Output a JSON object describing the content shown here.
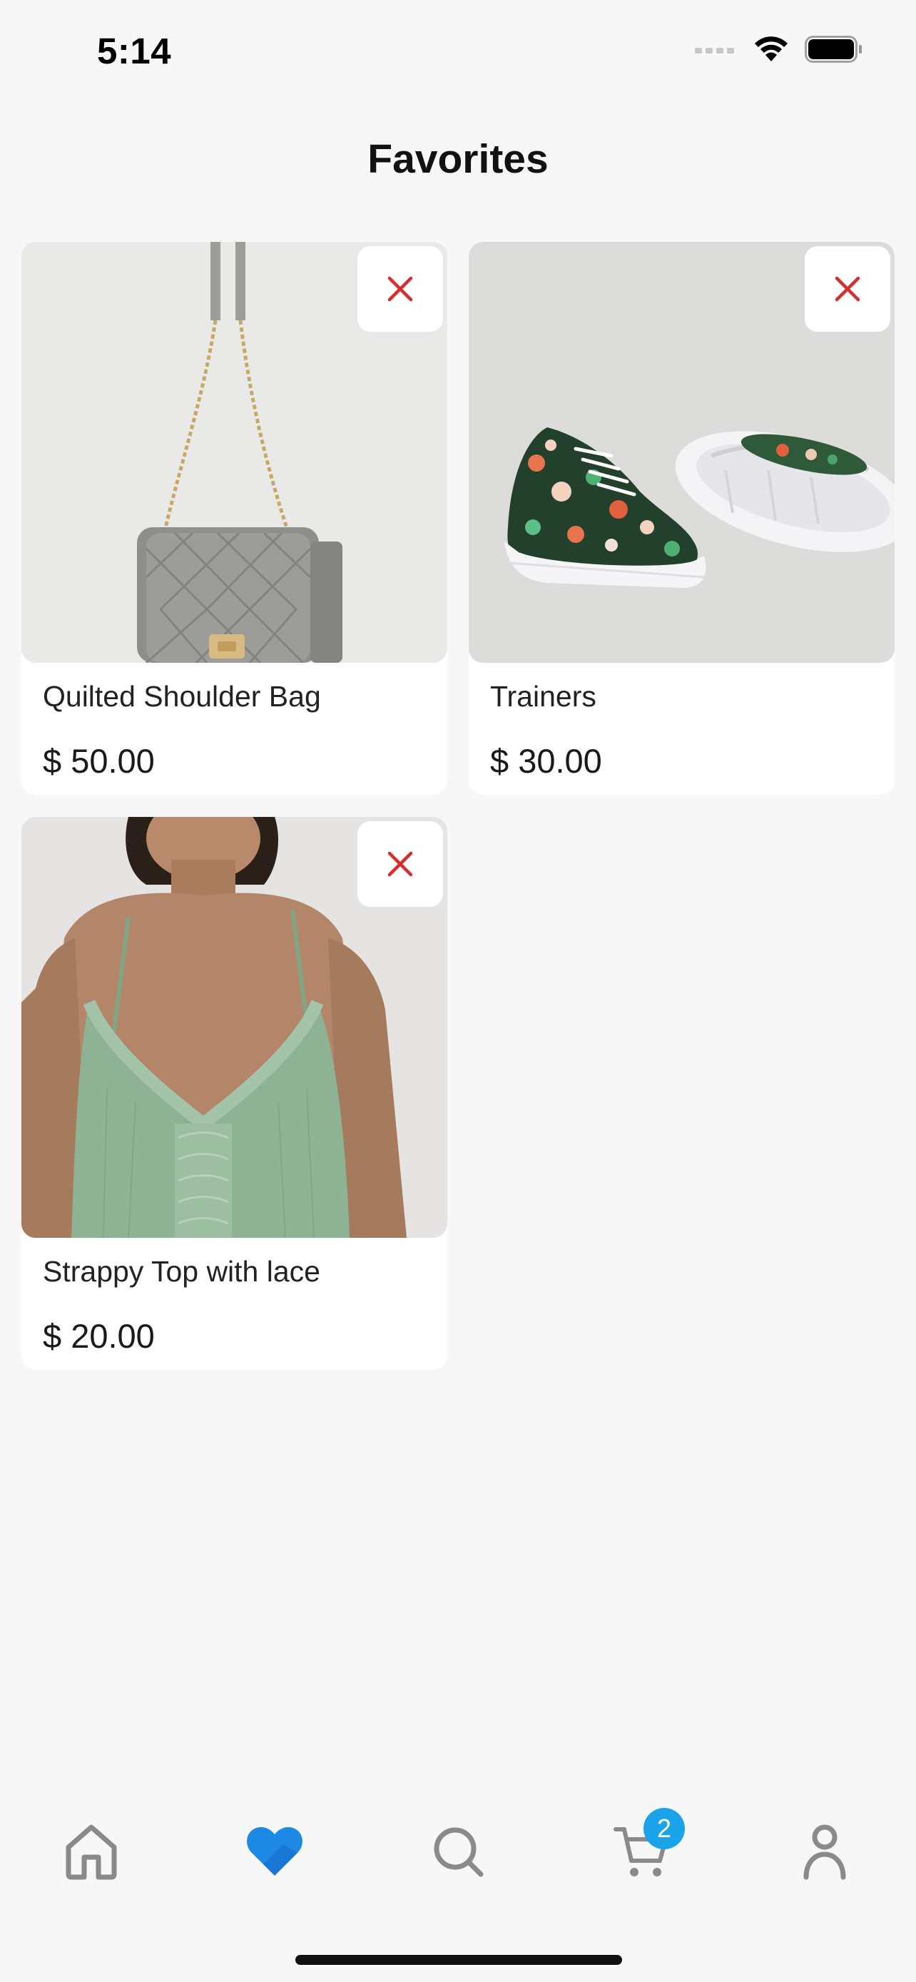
{
  "status_bar": {
    "time": "5:14",
    "icons": [
      "cellular-signal-icon",
      "wifi-icon",
      "battery-icon"
    ]
  },
  "page": {
    "title": "Favorites"
  },
  "favorites": [
    {
      "name": "Quilted Shoulder Bag",
      "price": "$ 50.00",
      "image": "grey-quilted-shoulder-bag-photo"
    },
    {
      "name": "Trainers",
      "price": "$ 30.00",
      "image": "floral-trainers-photo"
    },
    {
      "name": "Strappy Top with lace",
      "price": "$ 20.00",
      "image": "green-strappy-lace-top-photo"
    }
  ],
  "tab_bar": {
    "tabs": [
      {
        "icon": "home-icon",
        "active": false
      },
      {
        "icon": "heart-icon",
        "active": true
      },
      {
        "icon": "search-icon",
        "active": false
      },
      {
        "icon": "cart-icon",
        "active": false,
        "badge": "2"
      },
      {
        "icon": "profile-icon",
        "active": false
      }
    ]
  },
  "colors": {
    "background": "#f7f7f7",
    "card": "#ffffff",
    "remove_icon": "#d32f2f",
    "active_tab": "#1e88e5",
    "inactive_tab": "#8a8a8a",
    "badge": "#1aa3e8"
  }
}
